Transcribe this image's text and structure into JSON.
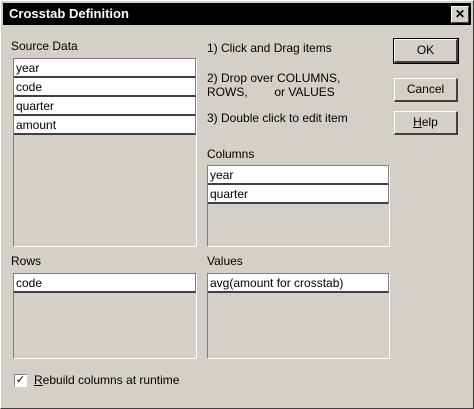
{
  "window": {
    "title": "Crosstab Definition",
    "close_glyph": "✕"
  },
  "source": {
    "label": "Source Data",
    "items": [
      "year",
      "code",
      "quarter",
      "amount"
    ]
  },
  "instructions": {
    "step1": "1) Click and Drag items",
    "step2": "2) Drop over COLUMNS,\nROWS,        or VALUES",
    "step3": "3) Double click to edit item"
  },
  "columns": {
    "label": "Columns",
    "items": [
      "year",
      "quarter"
    ]
  },
  "rows": {
    "label": "Rows",
    "items": [
      "code"
    ]
  },
  "values": {
    "label": "Values",
    "items": [
      "avg(amount for crosstab)"
    ]
  },
  "buttons": {
    "ok": "OK",
    "cancel": "Cancel",
    "help_first": "H",
    "help_rest": "elp"
  },
  "rebuild": {
    "checked": true,
    "check_glyph": "✓",
    "label_first": "R",
    "label_rest": "ebuild columns at runtime"
  }
}
